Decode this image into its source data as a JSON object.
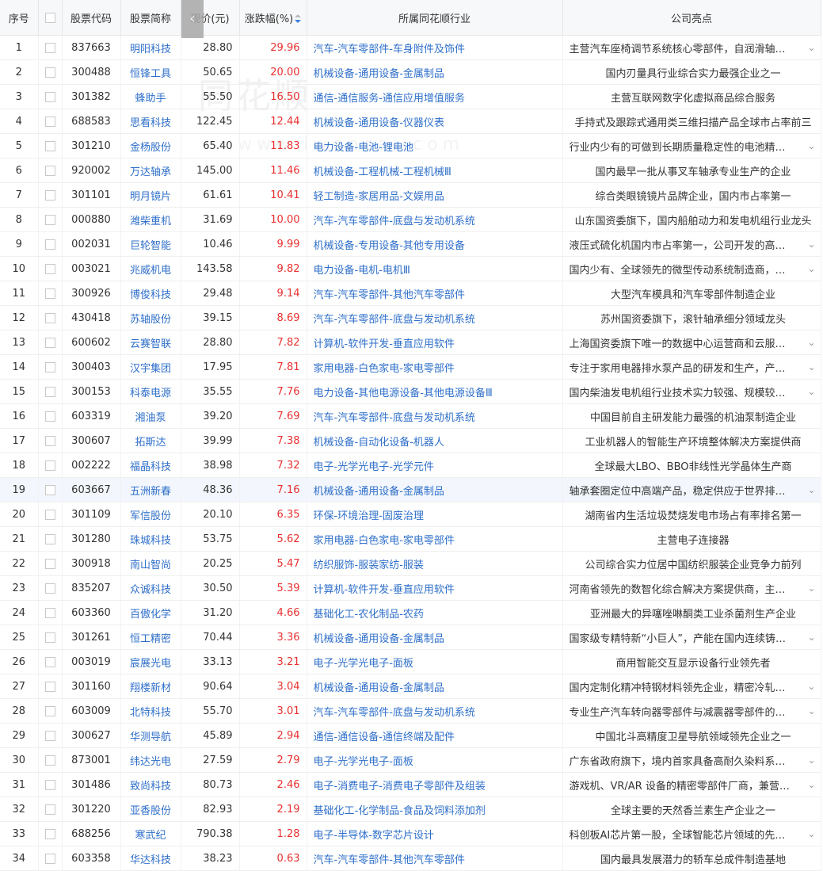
{
  "header": {
    "idx": "序号",
    "code": "股票代码",
    "name": "股票简称",
    "price": "现价(元)",
    "change": "涨跌幅(%)",
    "industry": "所属同花顺行业",
    "highlight": "公司亮点"
  },
  "watermark": {
    "main": "同花顺",
    "sub": "www.iwencai.com"
  },
  "collapse_icon": "chevron-left-icon",
  "colors": {
    "link": "#2f6fc9",
    "up": "#e93030",
    "selected_row": "#f3f7fd"
  },
  "rows": [
    {
      "idx": "1",
      "code": "837663",
      "name": "明阳科技",
      "price": "28.80",
      "change": "29.96",
      "industry": "汽车-汽车零部件-车身附件及饰件",
      "highlight": "主营汽车座椅调节系统核心零部件，自润滑轴…",
      "expand": true
    },
    {
      "idx": "2",
      "code": "300488",
      "name": "恒锋工具",
      "price": "50.65",
      "change": "20.00",
      "industry": "机械设备-通用设备-金属制品",
      "highlight": "国内刃量具行业综合实力最强企业之一",
      "expand": false
    },
    {
      "idx": "3",
      "code": "301382",
      "name": "蜂助手",
      "price": "55.50",
      "change": "16.50",
      "industry": "通信-通信服务-通信应用增值服务",
      "highlight": "主营互联网数字化虚拟商品综合服务",
      "expand": false
    },
    {
      "idx": "4",
      "code": "688583",
      "name": "思看科技",
      "price": "122.45",
      "change": "12.44",
      "industry": "机械设备-通用设备-仪器仪表",
      "highlight": "手持式及跟踪式通用类三维扫描产品全球市占率前三",
      "expand": false
    },
    {
      "idx": "5",
      "code": "301210",
      "name": "金杨股份",
      "price": "65.40",
      "change": "11.83",
      "industry": "电力设备-电池-锂电池",
      "highlight": "行业内少有的可做到长期质量稳定性的电池精…",
      "expand": true
    },
    {
      "idx": "6",
      "code": "920002",
      "name": "万达轴承",
      "price": "145.00",
      "change": "11.46",
      "industry": "机械设备-工程机械-工程机械Ⅲ",
      "highlight": "国内最早一批从事叉车轴承专业生产的企业",
      "expand": false
    },
    {
      "idx": "7",
      "code": "301101",
      "name": "明月镜片",
      "price": "61.61",
      "change": "10.41",
      "industry": "轻工制造-家居用品-文娱用品",
      "highlight": "综合类眼镜镜片品牌企业，国内市占率第一",
      "expand": false
    },
    {
      "idx": "8",
      "code": "000880",
      "name": "潍柴重机",
      "price": "31.69",
      "change": "10.00",
      "industry": "汽车-汽车零部件-底盘与发动机系统",
      "highlight": "山东国资委旗下，国内船舶动力和发电机组行业龙头",
      "expand": false
    },
    {
      "idx": "9",
      "code": "002031",
      "name": "巨轮智能",
      "price": "10.46",
      "change": "9.99",
      "industry": "机械设备-专用设备-其他专用设备",
      "highlight": "液压式硫化机国内市占率第一，公司开发的高…",
      "expand": true
    },
    {
      "idx": "10",
      "code": "003021",
      "name": "兆威机电",
      "price": "143.58",
      "change": "9.82",
      "industry": "电力设备-电机-电机Ⅲ",
      "highlight": "国内少有、全球领先的微型传动系统制造商，…",
      "expand": true
    },
    {
      "idx": "11",
      "code": "300926",
      "name": "博俊科技",
      "price": "29.48",
      "change": "9.14",
      "industry": "汽车-汽车零部件-其他汽车零部件",
      "highlight": "大型汽车模具和汽车零部件制造企业",
      "expand": false
    },
    {
      "idx": "12",
      "code": "430418",
      "name": "苏轴股份",
      "price": "39.15",
      "change": "8.69",
      "industry": "汽车-汽车零部件-底盘与发动机系统",
      "highlight": "苏州国资委旗下，滚针轴承细分领域龙头",
      "expand": false
    },
    {
      "idx": "13",
      "code": "600602",
      "name": "云赛智联",
      "price": "28.80",
      "change": "7.82",
      "industry": "计算机-软件开发-垂直应用软件",
      "highlight": "上海国资委旗下唯一的数据中心运营商和云服…",
      "expand": true
    },
    {
      "idx": "14",
      "code": "300403",
      "name": "汉宇集团",
      "price": "17.95",
      "change": "7.81",
      "industry": "家用电器-白色家电-家电零部件",
      "highlight": "专注于家用电器排水泵产品的研发和生产，产…",
      "expand": true
    },
    {
      "idx": "15",
      "code": "300153",
      "name": "科泰电源",
      "price": "35.55",
      "change": "7.76",
      "industry": "电力设备-其他电源设备-其他电源设备Ⅲ",
      "highlight": "国内柴油发电机组行业技术实力较强、规模较…",
      "expand": true
    },
    {
      "idx": "16",
      "code": "603319",
      "name": "湘油泵",
      "price": "39.20",
      "change": "7.69",
      "industry": "汽车-汽车零部件-底盘与发动机系统",
      "highlight": "中国目前自主研发能力最强的机油泵制造企业",
      "expand": false
    },
    {
      "idx": "17",
      "code": "300607",
      "name": "拓斯达",
      "price": "39.99",
      "change": "7.38",
      "industry": "机械设备-自动化设备-机器人",
      "highlight": "工业机器人的智能生产环境整体解决方案提供商",
      "expand": false
    },
    {
      "idx": "18",
      "code": "002222",
      "name": "福晶科技",
      "price": "38.98",
      "change": "7.32",
      "industry": "电子-光学光电子-光学元件",
      "highlight": "全球最大LBO、BBO非线性光学晶体生产商",
      "expand": false
    },
    {
      "idx": "19",
      "code": "603667",
      "name": "五洲新春",
      "price": "48.36",
      "change": "7.16",
      "industry": "机械设备-通用设备-金属制品",
      "highlight": "轴承套圈定位中高端产品，稳定供应于世界排…",
      "expand": true,
      "selected": true
    },
    {
      "idx": "20",
      "code": "301109",
      "name": "军信股份",
      "price": "20.10",
      "change": "6.35",
      "industry": "环保-环境治理-固废治理",
      "highlight": "湖南省内生活垃圾焚烧发电市场占有率排名第一",
      "expand": false
    },
    {
      "idx": "21",
      "code": "301280",
      "name": "珠城科技",
      "price": "53.75",
      "change": "5.62",
      "industry": "家用电器-白色家电-家电零部件",
      "highlight": "主营电子连接器",
      "expand": false
    },
    {
      "idx": "22",
      "code": "300918",
      "name": "南山智尚",
      "price": "20.25",
      "change": "5.47",
      "industry": "纺织服饰-服装家纺-服装",
      "highlight": "公司综合实力位居中国纺织服装企业竞争力前列",
      "expand": false
    },
    {
      "idx": "23",
      "code": "835207",
      "name": "众诚科技",
      "price": "30.50",
      "change": "5.39",
      "industry": "计算机-软件开发-垂直应用软件",
      "highlight": "河南省领先的数智化综合解决方案提供商，主…",
      "expand": true
    },
    {
      "idx": "24",
      "code": "603360",
      "name": "百傲化学",
      "price": "31.20",
      "change": "4.66",
      "industry": "基础化工-农化制品-农药",
      "highlight": "亚洲最大的异噻唑啉酮类工业杀菌剂生产企业",
      "expand": false
    },
    {
      "idx": "25",
      "code": "301261",
      "name": "恒工精密",
      "price": "70.44",
      "change": "3.36",
      "industry": "机械设备-通用设备-金属制品",
      "highlight": "国家级专精特新“小巨人”，产能在国内连续铸…",
      "expand": true
    },
    {
      "idx": "26",
      "code": "003019",
      "name": "宸展光电",
      "price": "33.13",
      "change": "3.21",
      "industry": "电子-光学光电子-面板",
      "highlight": "商用智能交互显示设备行业领先者",
      "expand": false
    },
    {
      "idx": "27",
      "code": "301160",
      "name": "翔楼新材",
      "price": "90.64",
      "change": "3.04",
      "industry": "机械设备-通用设备-金属制品",
      "highlight": "国内定制化精冲特钢材料领先企业，精密冷轧…",
      "expand": true
    },
    {
      "idx": "28",
      "code": "603009",
      "name": "北特科技",
      "price": "55.70",
      "change": "3.01",
      "industry": "汽车-汽车零部件-底盘与发动机系统",
      "highlight": "专业生产汽车转向器零部件与减震器零部件的…",
      "expand": true
    },
    {
      "idx": "29",
      "code": "300627",
      "name": "华测导航",
      "price": "45.89",
      "change": "2.94",
      "industry": "通信-通信设备-通信终端及配件",
      "highlight": "中国北斗高精度卫星导航领域领先企业之一",
      "expand": false
    },
    {
      "idx": "30",
      "code": "873001",
      "name": "纬达光电",
      "price": "27.59",
      "change": "2.79",
      "industry": "电子-光学光电子-面板",
      "highlight": "广东省政府旗下，境内首家具备高耐久染料系…",
      "expand": true
    },
    {
      "idx": "31",
      "code": "301486",
      "name": "致尚科技",
      "price": "80.73",
      "change": "2.46",
      "industry": "电子-消费电子-消费电子零部件及组装",
      "highlight": "游戏机、VR/AR 设备的精密零部件厂商，兼营…",
      "expand": true
    },
    {
      "idx": "32",
      "code": "301220",
      "name": "亚香股份",
      "price": "82.93",
      "change": "2.19",
      "industry": "基础化工-化学制品-食品及饲料添加剂",
      "highlight": "全球主要的天然香兰素生产企业之一",
      "expand": false
    },
    {
      "idx": "33",
      "code": "688256",
      "name": "寒武纪",
      "price": "790.38",
      "change": "1.28",
      "industry": "电子-半导体-数字芯片设计",
      "highlight": "科创板AI芯片第一股，全球智能芯片领域的先…",
      "expand": true
    },
    {
      "idx": "34",
      "code": "603358",
      "name": "华达科技",
      "price": "38.23",
      "change": "0.63",
      "industry": "汽车-汽车零部件-其他汽车零部件",
      "highlight": "国内最具发展潜力的轿车总成件制造基地",
      "expand": false
    }
  ]
}
